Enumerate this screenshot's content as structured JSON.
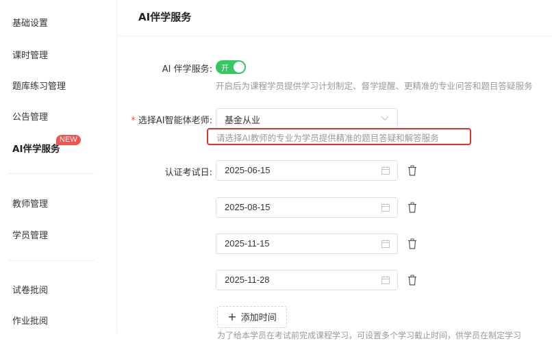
{
  "sidebar": {
    "items": [
      {
        "label": "基础设置"
      },
      {
        "label": "课时管理"
      },
      {
        "label": "题库练习管理"
      },
      {
        "label": "公告管理"
      },
      {
        "label": "AI伴学服务",
        "badge": "NEW"
      },
      {
        "label": "教师管理"
      },
      {
        "label": "学员管理"
      },
      {
        "label": "试卷批阅"
      },
      {
        "label": "作业批阅"
      }
    ]
  },
  "header": {
    "title": "AI伴学服务"
  },
  "form": {
    "service": {
      "label": "AI 伴学服务:",
      "switch_text": "开",
      "switch_on": true,
      "hint": "开启后为课程学员提供学习计划制定、督学提醒、更精准的专业问答和题目答疑服务"
    },
    "teacher": {
      "required_mark": "*",
      "label": "选择AI智能体老师:",
      "selected": "基金从业",
      "hint": "请选择AI教师的专业为学员提供精准的题目答疑和解答服务"
    },
    "exam_dates": {
      "label": "认证考试日:",
      "dates": [
        "2025-06-15",
        "2025-08-15",
        "2025-11-15",
        "2025-11-28"
      ]
    },
    "add_time_label": "添加时间",
    "bottom_note": "为了给本学员在考试前完成课程学习，可设置多个学习截止时间，供学员在制定学习"
  },
  "colors": {
    "accent": "#35c760",
    "badge": "#f5514f",
    "highlight_box": "#e0302c"
  }
}
